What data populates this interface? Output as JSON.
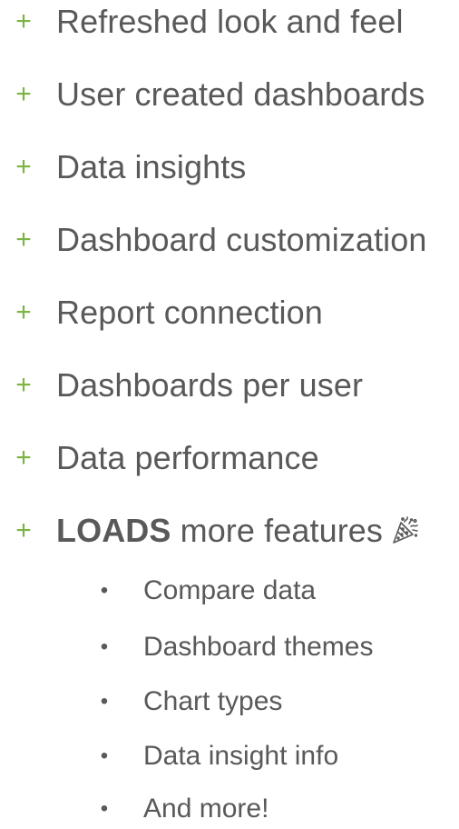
{
  "features": [
    {
      "marker": "+",
      "text": "Refreshed look and feel"
    },
    {
      "marker": "+",
      "text": "User created dashboards"
    },
    {
      "marker": "+",
      "text": "Data insights"
    },
    {
      "marker": "+",
      "text": "Dashboard customization"
    },
    {
      "marker": "+",
      "text": "Report connection"
    },
    {
      "marker": "+",
      "text": "Dashboards per user"
    },
    {
      "marker": "+",
      "text": "Data performance"
    },
    {
      "marker": "+",
      "bold": "LOADS",
      "text": " more features",
      "icon": "party-popper-icon"
    }
  ],
  "sub_features": [
    {
      "marker": "•",
      "text": "Compare data"
    },
    {
      "marker": "•",
      "text": "Dashboard themes"
    },
    {
      "marker": "•",
      "text": "Chart types"
    },
    {
      "marker": "•",
      "text": "Data insight info"
    },
    {
      "marker": "•",
      "text": "And more!"
    }
  ],
  "colors": {
    "plus_marker": "#7cb342",
    "text": "#595959"
  }
}
